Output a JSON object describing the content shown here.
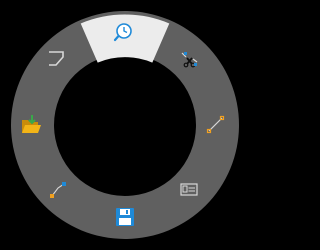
{
  "menu": {
    "items": [
      {
        "icon": "history-clock-search-icon",
        "state": "highlighted"
      },
      {
        "icon": "trim-scissors-icon",
        "state": "normal"
      },
      {
        "icon": "line-segment-icon",
        "state": "normal"
      },
      {
        "icon": "properties-card-icon",
        "state": "normal"
      },
      {
        "icon": "save-floppy-disk-icon",
        "state": "normal"
      },
      {
        "icon": "connect-points-icon",
        "state": "normal"
      },
      {
        "icon": "open-folder-icon",
        "state": "normal"
      },
      {
        "icon": "polyline-sketch-icon",
        "state": "normal"
      }
    ]
  },
  "colors": {
    "background": "#000000",
    "ring": "#606060",
    "highlight": "#ececec",
    "icon_stroke": "#1a1a1a",
    "icon_light": "#d8d8d8",
    "accent_blue": "#1f8ad8",
    "accent_orange": "#f0a020",
    "folder_yellow": "#f2b417",
    "arrow_green": "#3aa84a"
  }
}
